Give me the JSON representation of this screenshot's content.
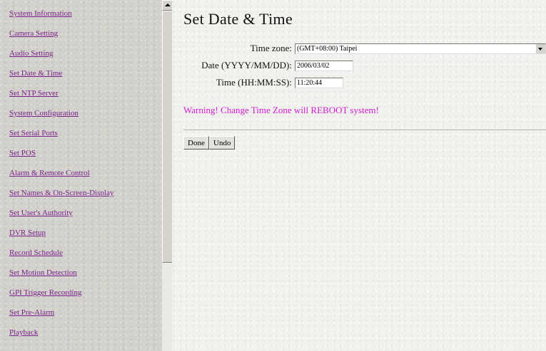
{
  "nav": {
    "items": [
      "System Information",
      "Camera Setting",
      "Audio Setting",
      "Set Date & Time",
      "Set NTP Server",
      "System Configuration",
      "Set Serial Ports",
      "Set POS",
      "Alarm & Remote Control",
      "Set Names & On-Screen-Display",
      "Set User's Authority",
      "DVR Setup",
      "Record Schedule",
      "Set Motion Detection",
      "GPI Trigger Recording",
      "Set Pre-Alarm",
      "Playback"
    ]
  },
  "page": {
    "title": "Set Date & Time"
  },
  "form": {
    "timezone_label": "Time zone:",
    "timezone_value": "(GMT+08:00) Taipei",
    "date_label": "Date (YYYY/MM/DD):",
    "date_value": "2006/03/02",
    "time_label": "Time (HH:MM:SS):",
    "time_value": "11:20:44"
  },
  "warning": "Warning! Change Time Zone will REBOOT system!",
  "buttons": {
    "done": "Done",
    "undo": "Undo"
  },
  "colors": {
    "link": "#7a1f8c",
    "warning": "#d21ad2"
  }
}
